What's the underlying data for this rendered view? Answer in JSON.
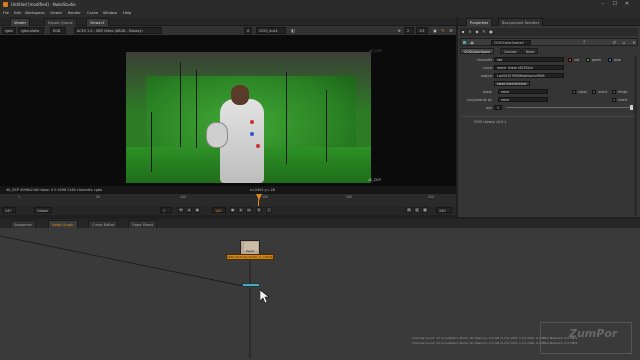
{
  "window": {
    "title": "Untitled [modified] - NukeStudio",
    "controls": [
      "–",
      "☐",
      "✕"
    ]
  },
  "menu": [
    "File",
    "Edit",
    "Workspace",
    "Viewer",
    "Render",
    "Cache",
    "Window",
    "Help"
  ],
  "top_tabs": {
    "viewer": "Viewer",
    "export_queue": "Export Queue",
    "viewer1": "Viewer1",
    "properties": "Properties",
    "background_renders": "Background Renders"
  },
  "viewer_toolbar": {
    "layer": "rgba",
    "channel": "rgba.alpha",
    "colorspace": "RGB",
    "display": "ACES 1.0 - SDR Video (ARGB - Display)",
    "input": "A",
    "node": "OCIO_aux1",
    "zoom": "2",
    "proxy": "1/3"
  },
  "viewer": {
    "format_corner": "4K_DCP",
    "plate_label": "4K_DCP",
    "info_left": "4K_DCP 4096x2160  bbox: 0 0 4096 2160 channels: rgba",
    "info_right": "x=2402 y=-28"
  },
  "timeline": {
    "fps": "24*",
    "scope": "Global",
    "ticks": [
      "1",
      "50",
      "100",
      "150",
      "200",
      "250"
    ],
    "current_frame": "140",
    "in_frame": "1",
    "out_frame": "240",
    "end_label": "250"
  },
  "bottom_tabs": [
    "Sequence",
    "Node Graph",
    "Curve Editor",
    "Dope Sheet"
  ],
  "nodes": {
    "read_label": "Read1",
    "read_sub": "ARRI_Ma21Ast_hdr02_s1_COLOR_RAWx.mov",
    "ocio_label": "OCIOColorSpace1"
  },
  "properties": {
    "node_name": "OCIOColorSpace1",
    "tabs": [
      "OCIOColorSpace",
      "Context",
      "Node"
    ],
    "rows": {
      "channels_label": "channels",
      "channels_value": "rgb",
      "red": "red",
      "green": "green",
      "blue": "blue",
      "input_label": "input",
      "input_value": "scene_linear (ACES2g)",
      "output_label": "output",
      "output_value": "Log3G10 REDWideGamutRGB",
      "swap_label": "swap input/output",
      "mask_label": "mask",
      "mask_value": "none",
      "inject": "inject",
      "invert": "invert",
      "fringe": "fringe",
      "unpremult_label": "(un)premult by",
      "unpremult_value": "none",
      "mix_label": "mix",
      "mix_value": "1",
      "library": "OCIO Library: v2.0.1"
    }
  },
  "status_lines": [
    "Channel Count: 22 Localization Mode: On Memory: 0.4 GB (5.2%) CPU: 1.1% Disk: 0.0 MB/s Network: 0.0 MB/s",
    "Channel Count: 22 Localization Mode: On Memory: 0.4 GB (5.2%) CPU: 1.1% Disk: 0.0 MB/s Network: 0.0 MB/s"
  ],
  "watermark": "ZumPor",
  "colors": {
    "read_node": "#b8a892",
    "read_label": "#d08a1a",
    "ocio_node": "#4da6b4",
    "current_frame": "#e08a1a"
  }
}
